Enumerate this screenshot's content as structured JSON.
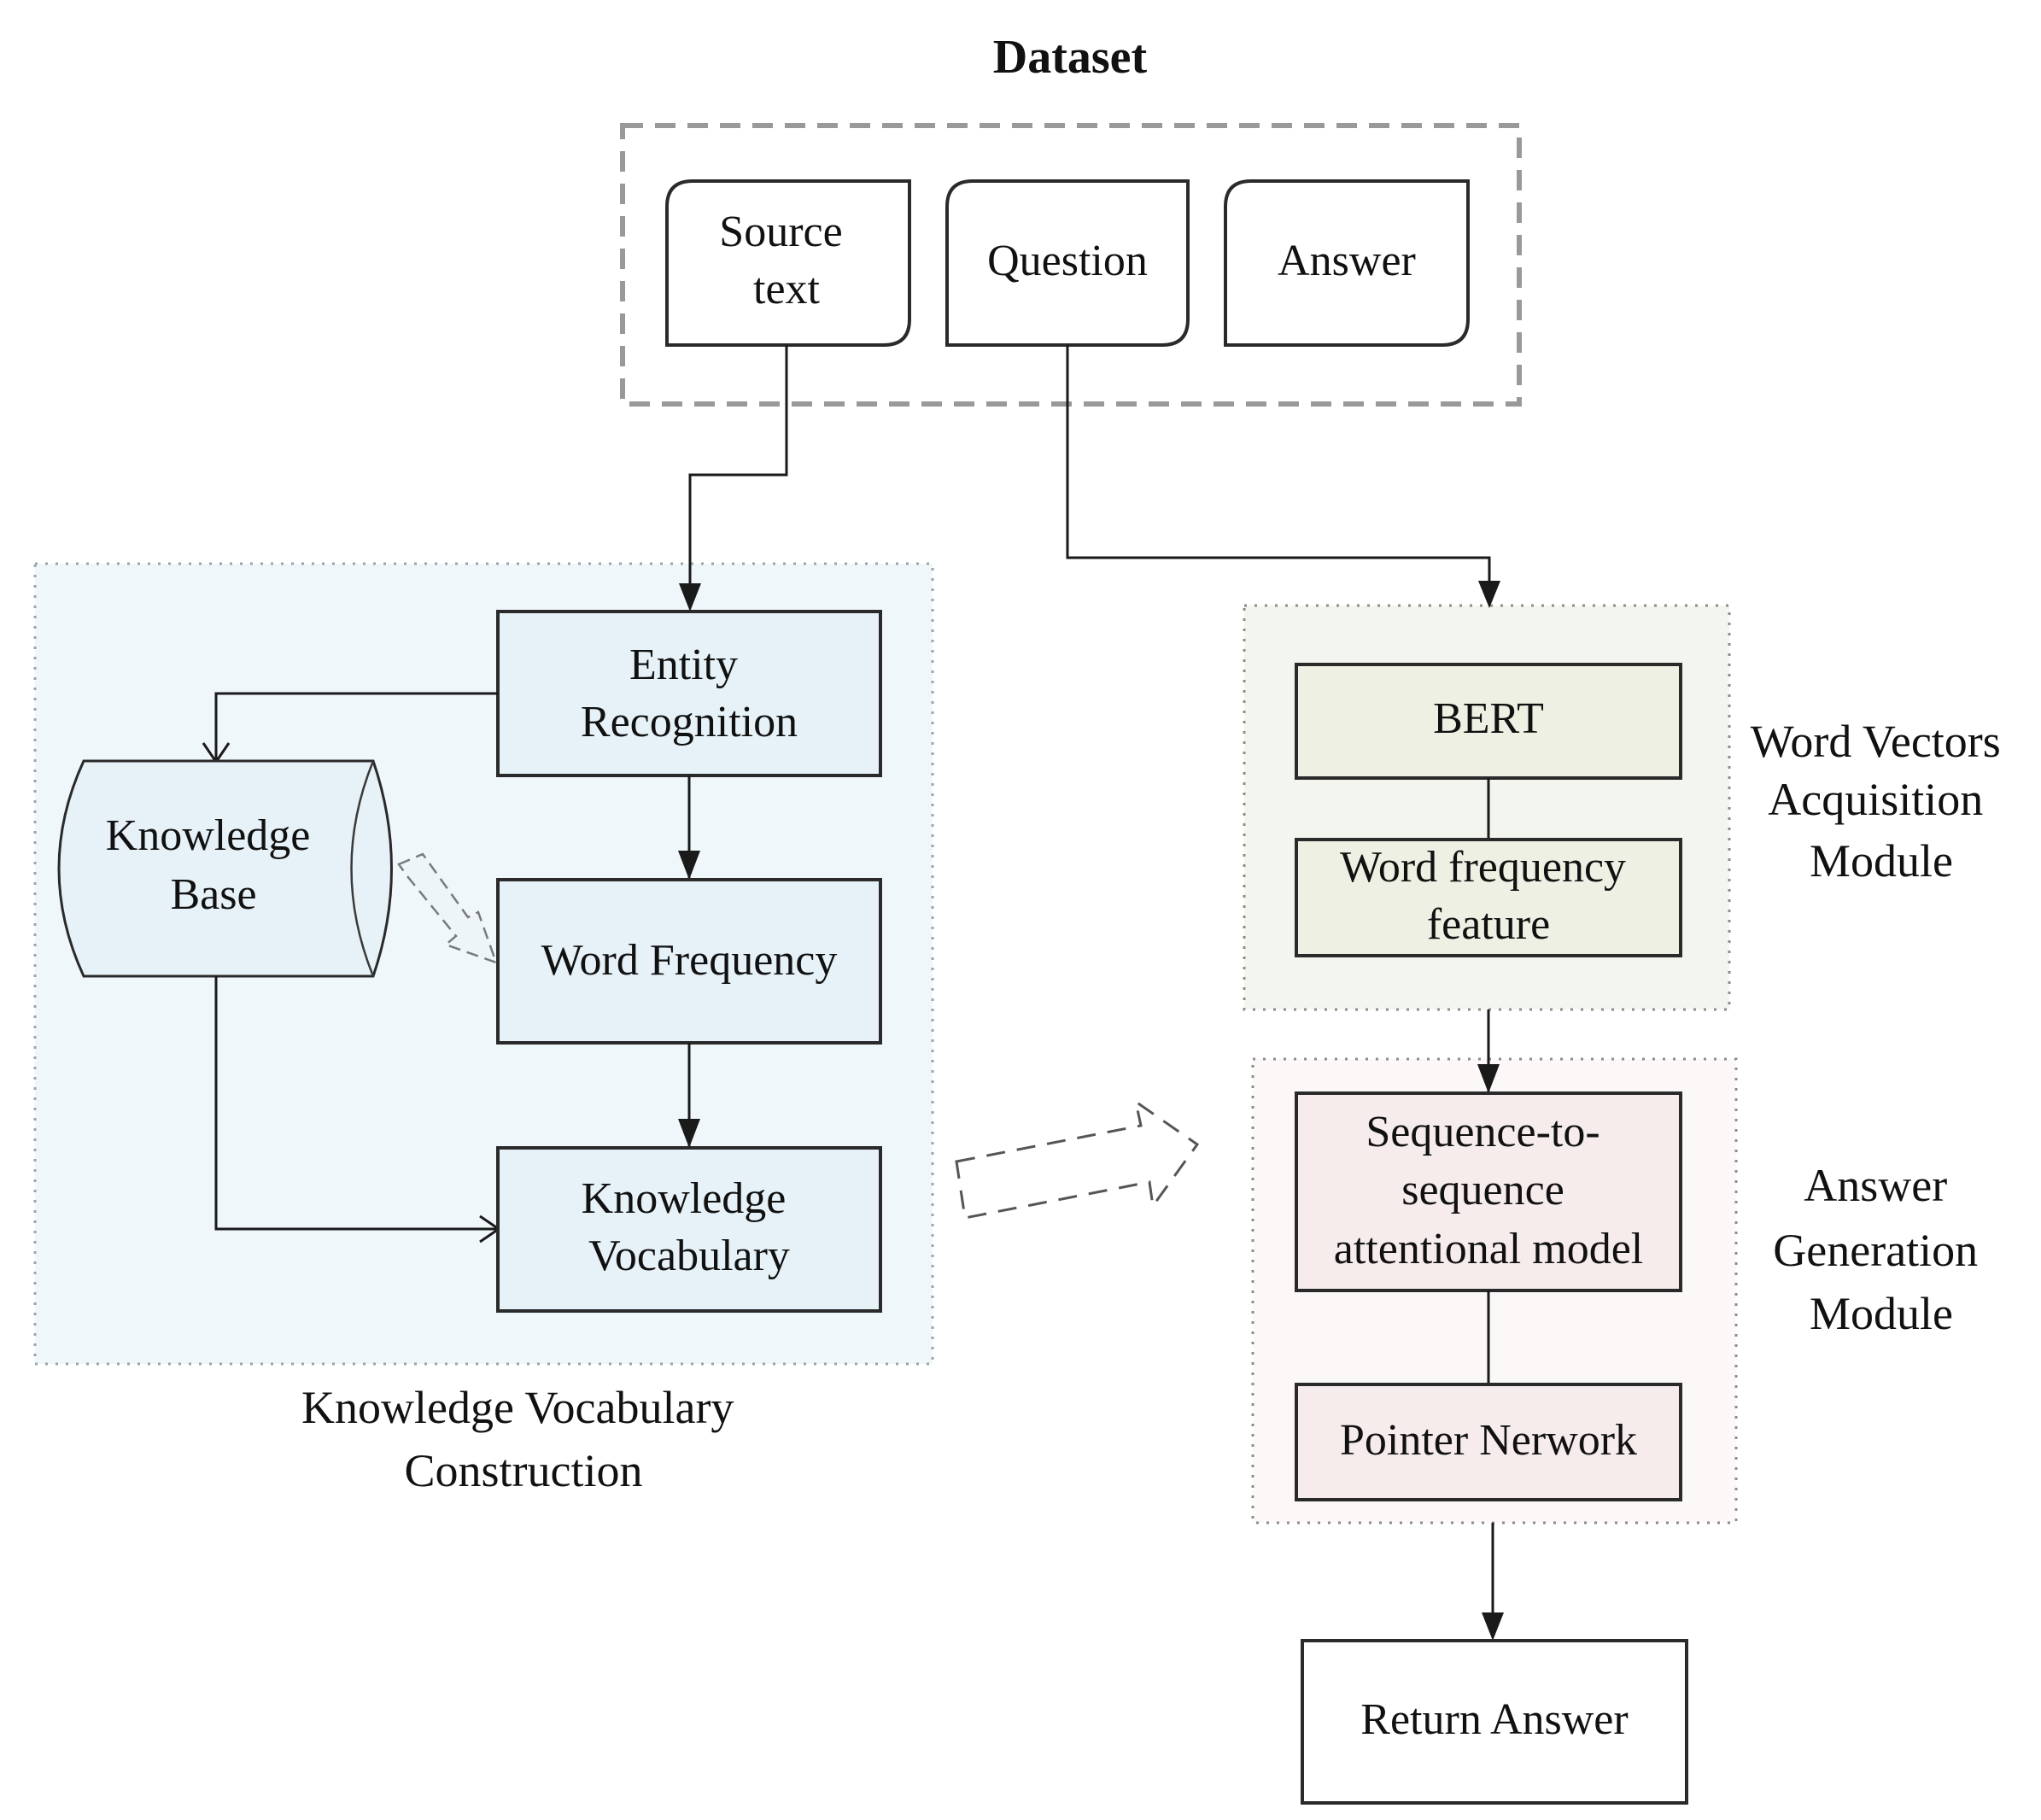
{
  "title": "Dataset",
  "dataset": {
    "items": [
      {
        "id": "source_text",
        "lines": [
          "Source",
          "text"
        ]
      },
      {
        "id": "question",
        "lines": [
          "Question"
        ]
      },
      {
        "id": "answer",
        "lines": [
          "Answer"
        ]
      }
    ]
  },
  "knowledge_vocabulary_construction": {
    "label_lines": [
      "Knowledge Vocabulary",
      "Construction"
    ],
    "entity_recognition": [
      "Entity",
      "Recognition"
    ],
    "knowledge_base": [
      "Knowledge",
      "Base"
    ],
    "word_frequency": [
      "Word Frequency"
    ],
    "knowledge_vocabulary": [
      "Knowledge",
      "Vocabulary"
    ]
  },
  "word_vectors_module": {
    "label_lines": [
      "Word Vectors",
      "Acquisition",
      "Module"
    ],
    "bert": [
      "BERT"
    ],
    "word_frequency_feature": [
      "Word frequency",
      "feature"
    ]
  },
  "answer_generation_module": {
    "label_lines": [
      "Answer",
      "Generation",
      "Module"
    ],
    "seq2seq": [
      "Sequence-to-",
      "sequence",
      "attentional model"
    ],
    "pointer_network": [
      "Pointer Nerwork"
    ]
  },
  "return_answer": [
    "Return Answer"
  ],
  "colors": {
    "kvc_region": "#f0f7fa",
    "kvc_box": "#e6f2f7",
    "wva_region": "#f3f6ee",
    "wva_box": "#edf0e2",
    "agm_region": "#fbf8f7",
    "agm_box": "#f6ecec",
    "dataset_border": "#999999"
  }
}
